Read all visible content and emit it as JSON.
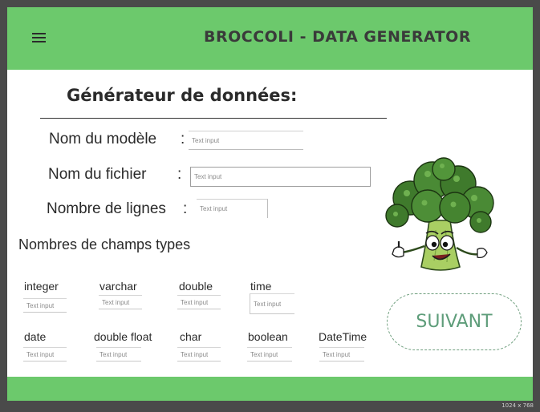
{
  "header": {
    "title": "BROCCOLI - DATA GENERATOR",
    "menu_icon": "hamburger-menu-icon"
  },
  "page": {
    "heading": "Générateur de données:"
  },
  "form": {
    "modele": {
      "label": "Nom du modèle",
      "colon": ":",
      "placeholder": "Text input"
    },
    "fichier": {
      "label": "Nom du fichier",
      "colon": ":",
      "placeholder": "Text input"
    },
    "lignes": {
      "label": "Nombre de lignes",
      "colon": ":",
      "placeholder": "Text input"
    }
  },
  "types_section": {
    "label": "Nombres de champs types",
    "row1": [
      {
        "label": "integer",
        "placeholder": "Text input"
      },
      {
        "label": "varchar",
        "placeholder": "Text input"
      },
      {
        "label": "double",
        "placeholder": "Text input"
      },
      {
        "label": "time",
        "placeholder": "Text input"
      }
    ],
    "row2": [
      {
        "label": "date",
        "placeholder": "Text input"
      },
      {
        "label": "double  float",
        "placeholder": "Text input"
      },
      {
        "label": "char",
        "placeholder": "Text input"
      },
      {
        "label": "boolean",
        "placeholder": "Text input"
      },
      {
        "label": "DateTime",
        "placeholder": "Text input"
      }
    ]
  },
  "actions": {
    "next_label": "SUIVANT"
  },
  "illustration": {
    "icon": "broccoli-mascot-icon"
  },
  "canvas_info": {
    "dimensions": "1024 x 768"
  },
  "colors": {
    "header": "#6cc96c",
    "footer": "#6cc96c",
    "button_text": "#5e9d7a",
    "background": "#4a4a4a"
  }
}
